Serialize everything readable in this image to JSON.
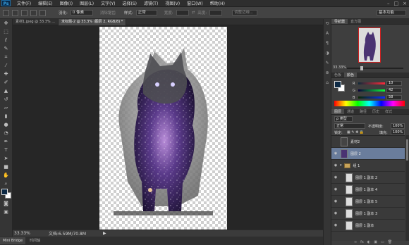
{
  "app": {
    "logo": "Ps"
  },
  "menubar": {
    "items": [
      "文件(F)",
      "编辑(E)",
      "图像(I)",
      "图层(L)",
      "文字(Y)",
      "选择(S)",
      "滤镜(T)",
      "视图(V)",
      "窗口(W)",
      "帮助(H)"
    ]
  },
  "window_controls": {
    "minimize": "–",
    "maximize": "□",
    "close": "×"
  },
  "options_bar": {
    "feather_label": "羽化:",
    "feather_value": "0 像素",
    "antialias_label": "消除锯齿",
    "style_label": "样式:",
    "style_value": "正常",
    "width_label": "宽度:",
    "height_label": "高度:",
    "refine_button": "调整边缘...",
    "workspace": "基本功能"
  },
  "tabs": [
    {
      "label": "素材1.jpeg @ 33.3% ...",
      "active": false
    },
    {
      "label": "未标题-2 @ 33.3% (图层 2, RGB/8) *",
      "active": true
    }
  ],
  "status": {
    "zoom": "33.33%",
    "doc": "文档:6.59M/70.8M"
  },
  "bottom_tabs": [
    "Mini Bridge",
    "时间轴"
  ],
  "navigator": {
    "tabs": [
      "导航器",
      "直方图"
    ],
    "zoom": "33.33%",
    "zoom_fraction": 0.25
  },
  "color_panel": {
    "tabs": [
      "色板",
      "颜色"
    ],
    "channels": [
      {
        "label": "R",
        "value": "10",
        "color": "#e03030"
      },
      {
        "label": "G",
        "value": "42",
        "color": "#30c030"
      },
      {
        "label": "B",
        "value": "58",
        "color": "#3060e0"
      }
    ],
    "foreground": "#0e2a45",
    "background": "#ffffff"
  },
  "layers_panel": {
    "tabs": [
      "图层",
      "通道",
      "路径",
      "历史",
      "样式"
    ],
    "filter_label": "ρ 类型",
    "blend_mode": "正常",
    "opacity_label": "不透明度:",
    "opacity_value": "100%",
    "lock_label": "锁定:",
    "fill_label": "填充:",
    "fill_value": "100%",
    "layers": [
      {
        "name": "素材2",
        "selected": false,
        "visible": false,
        "group": false
      },
      {
        "name": "图层 2",
        "selected": true,
        "visible": true,
        "group": false
      },
      {
        "name": "组 1",
        "selected": false,
        "visible": true,
        "group": true
      },
      {
        "name": "图层 1 副本 2",
        "selected": false,
        "visible": true,
        "group": false
      },
      {
        "name": "图层 1 副本 4",
        "selected": false,
        "visible": true,
        "group": false
      },
      {
        "name": "图层 1 副本 5",
        "selected": false,
        "visible": true,
        "group": false
      },
      {
        "name": "图层 1 副本 3",
        "selected": false,
        "visible": true,
        "group": false
      },
      {
        "name": "图层 1 副本",
        "selected": false,
        "visible": true,
        "group": false
      }
    ],
    "footer": [
      "∞",
      "fx",
      "◐",
      "▣",
      "▭",
      "🗑"
    ]
  }
}
